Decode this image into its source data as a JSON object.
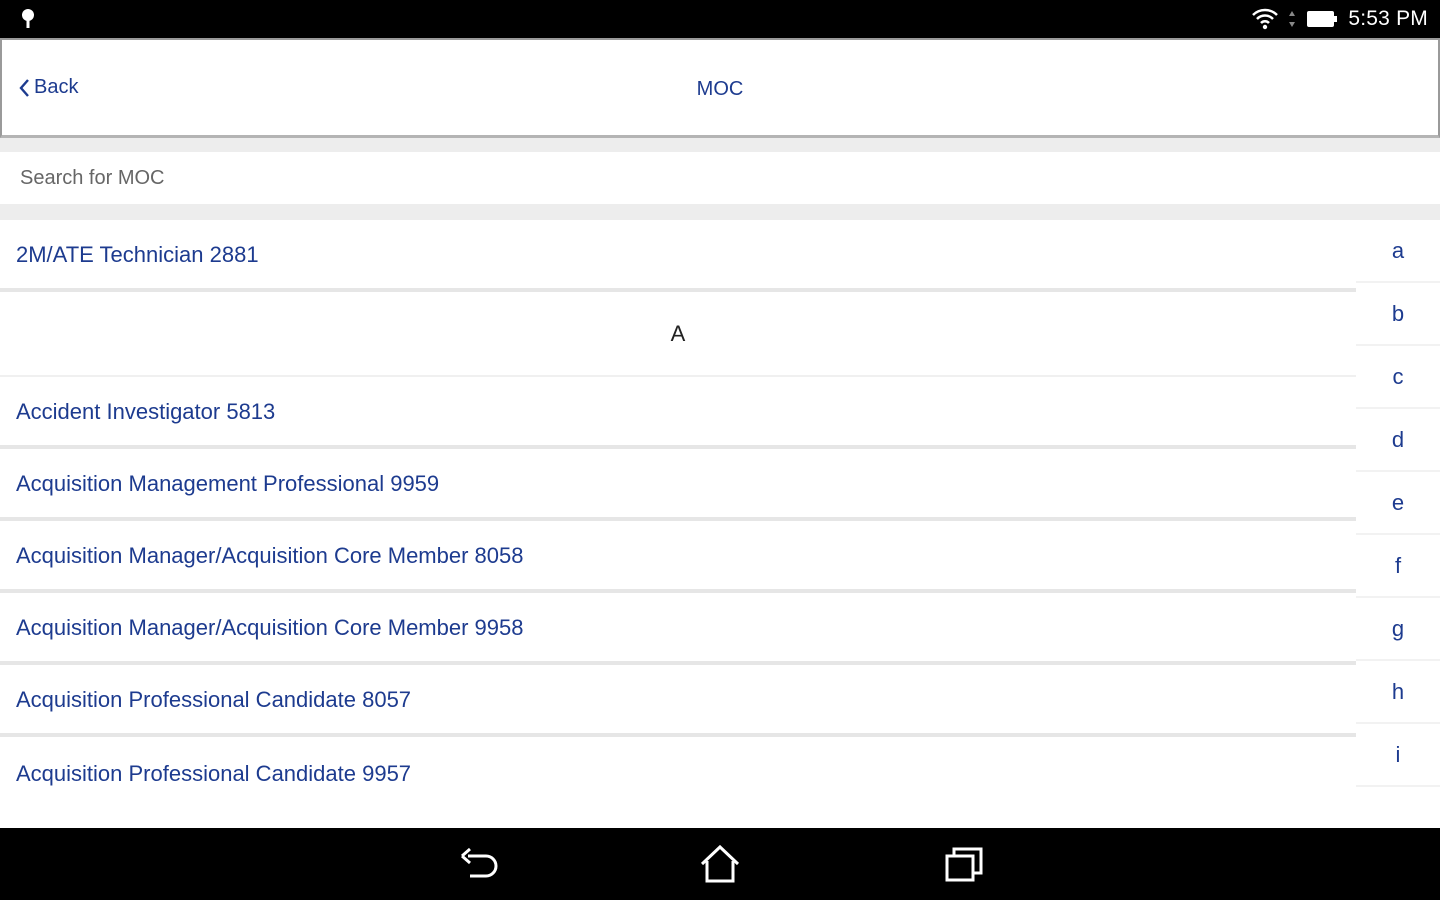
{
  "status_bar": {
    "time": "5:53 PM",
    "icons": [
      "location-icon",
      "wifi-icon",
      "battery-icon"
    ]
  },
  "header": {
    "back_label": "Back",
    "title": "MOC"
  },
  "search": {
    "placeholder": "Search for MOC"
  },
  "list": {
    "top_item": "2M/ATE Technician 2881",
    "section_a": "A",
    "items": [
      "Accident Investigator 5813",
      "Acquisition Management Professional 9959",
      "Acquisition Manager/Acquisition Core Member 8058",
      "Acquisition Manager/Acquisition Core Member 9958",
      "Acquisition Professional Candidate 8057",
      "Acquisition Professional Candidate 9957"
    ]
  },
  "index_bar": {
    "letters": [
      "a",
      "b",
      "c",
      "d",
      "e",
      "f",
      "g",
      "h",
      "i"
    ]
  },
  "nav_bar": {
    "icons": [
      "back-nav-icon",
      "home-icon",
      "recents-icon"
    ]
  },
  "colors": {
    "accent": "#1d3b8f",
    "status_bar": "#000000",
    "background": "#ffffff"
  }
}
